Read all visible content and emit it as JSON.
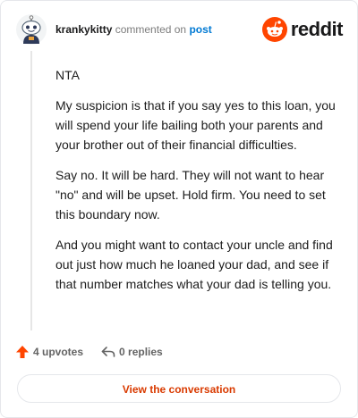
{
  "header": {
    "username": "krankykitty",
    "connector": "commented on",
    "post_link": "post",
    "brand_name": "reddit",
    "brand_color": "#ff4500"
  },
  "comment": {
    "paragraphs": [
      "NTA",
      "My suspicion is that if you say yes to this loan, you will spend your life bailing both your parents and your brother out of their financial difficulties.",
      "Say no. It will be hard. They will not want to hear \"no\" and will be upset. Hold firm. You need to set this boundary now.",
      "And you might want to contact your uncle and find out just how much he loaned your dad, and see if that number matches what your dad is telling you."
    ]
  },
  "actions": {
    "upvotes_label": "4 upvotes",
    "upvote_icon": "arrow-up-icon",
    "upvote_color": "#ff4500",
    "replies_label": "0 replies",
    "reply_icon": "reply-arrow-icon"
  },
  "cta": {
    "label": "View the conversation",
    "color": "#d93a00"
  }
}
